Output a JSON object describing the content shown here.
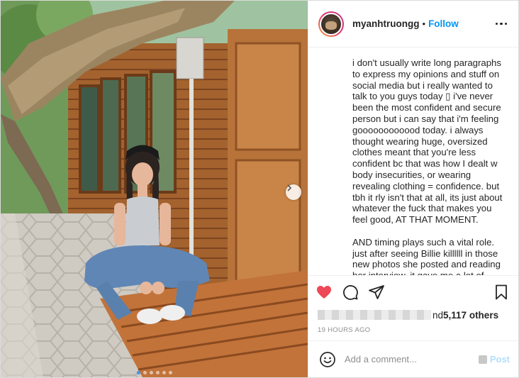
{
  "header": {
    "username": "myanhtruongg",
    "separator": "•",
    "follow_label": "Follow",
    "more_icon": "more-horizontal-icon"
  },
  "caption": {
    "paragraphs": [
      "i don't usually write long paragraphs to express my opinions and stuff on social media but i really wanted to talk to you guys today ▯ i've never been the most confident and secure person but i can say that i'm feeling goooooooooood today. i always thought wearing huge, oversized clothes meant that you're less confident bc that was how I dealt w body insecurities, or wearing revealing clothing = confidence. but tbh it rly isn't that at all, its just about whatever the fuck that makes you feel good, AT THAT MOMENT.",
      "AND timing plays such a vital role. just after seeing Billie killllll in those new photos she posted and reading her interview, it gave me a lot of insights."
    ]
  },
  "actions": {
    "like_icon": "heart-filled-icon",
    "comment_icon": "comment-icon",
    "share_icon": "share-icon",
    "save_icon": "bookmark-icon",
    "like_color": "#ed4956"
  },
  "likes": {
    "text": "nd ",
    "count": "5,117 others"
  },
  "timestamp": "19 HOURS AGO",
  "comment": {
    "placeholder": "Add a comment...",
    "post_label": "Post",
    "emoji_icon": "smiley-icon"
  },
  "carousel": {
    "slide_count": 6,
    "active_index": 0,
    "next_icon": "chevron-right-icon"
  },
  "colors": {
    "follow": "#0095f6",
    "post_disabled": "#b2dffc",
    "active_dot": "#3b96ee"
  }
}
